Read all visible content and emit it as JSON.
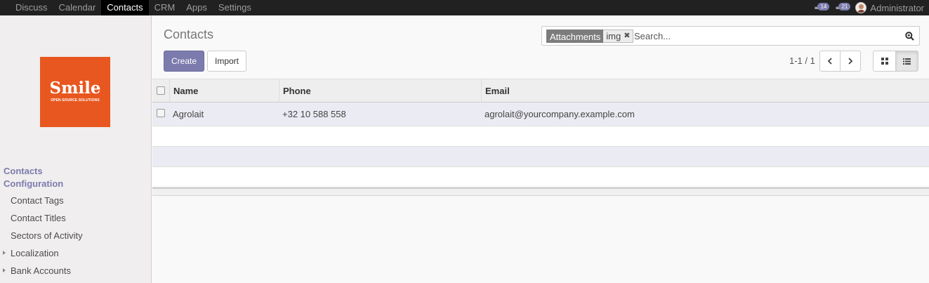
{
  "navbar": {
    "menu": [
      "Discuss",
      "Calendar",
      "Contacts",
      "CRM",
      "Apps",
      "Settings"
    ],
    "active": "Contacts",
    "activity_count": "14",
    "messages_count": "21",
    "user": "Administrator"
  },
  "sidebar": {
    "logo": {
      "word": "Smile",
      "tagline": "OPEN SOURCE SOLUTIONS"
    },
    "sections": [
      "Contacts",
      "Configuration"
    ],
    "items": [
      "Contact Tags",
      "Contact Titles",
      "Sectors of Activity",
      "Localization",
      "Bank Accounts"
    ]
  },
  "control_panel": {
    "title": "Contacts",
    "create_label": "Create",
    "import_label": "Import",
    "pager": "1-1 / 1",
    "search": {
      "facet_category": "Attachments",
      "facet_value": "img",
      "placeholder": "Search..."
    }
  },
  "list": {
    "columns": [
      "Name",
      "Phone",
      "Email"
    ],
    "rows": [
      {
        "name": "Agrolait",
        "phone": "+32 10 588 558",
        "email": "agrolait@yourcompany.example.com"
      }
    ]
  },
  "colors": {
    "navbar_bg": "#212121",
    "brand_accent": "#7c7bad",
    "logo_bg": "#e8571f"
  },
  "icons": [
    "comments-icon",
    "chat-icon",
    "magnifier-icon",
    "chevron-left-icon",
    "chevron-right-icon",
    "kanban-view-icon",
    "list-view-icon",
    "remove-facet-icon",
    "caret-right-icon"
  ]
}
